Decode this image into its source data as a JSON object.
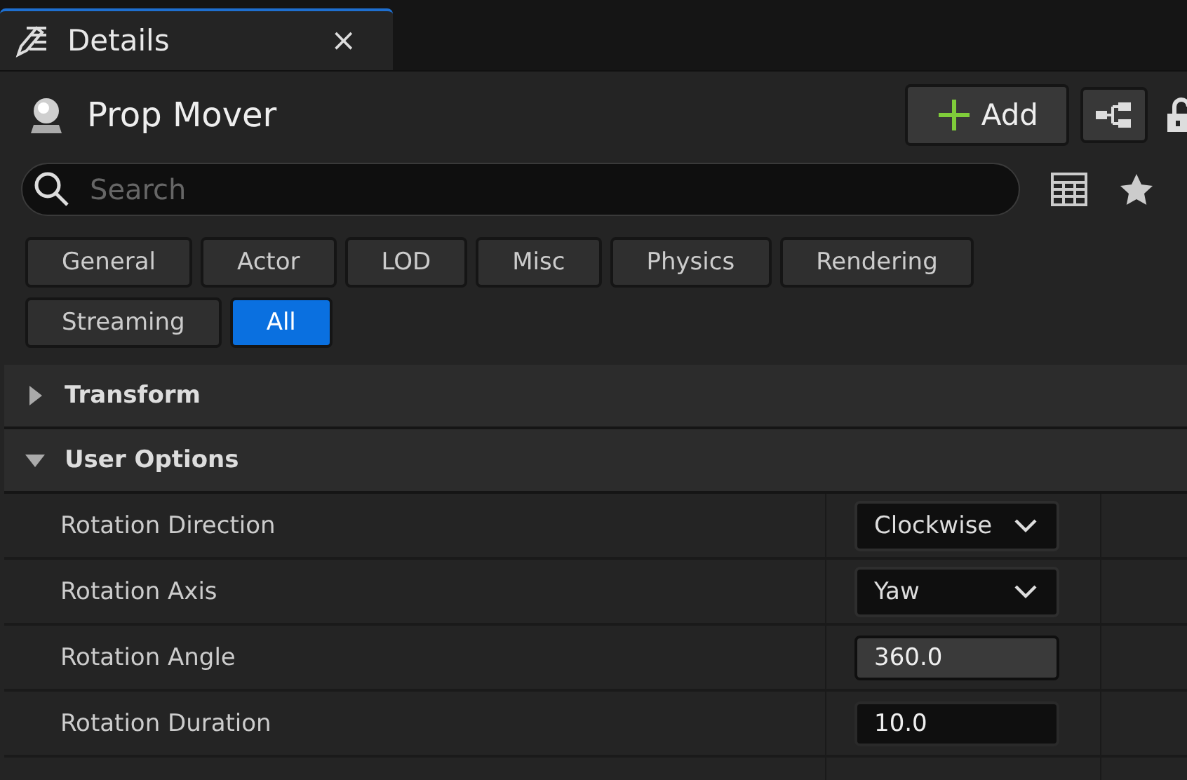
{
  "tab": {
    "title": "Details",
    "close": "×"
  },
  "header": {
    "title": "Prop Mover",
    "add_button": "Add"
  },
  "search": {
    "placeholder": "Search"
  },
  "filters": [
    {
      "label": "General",
      "selected": false
    },
    {
      "label": "Actor",
      "selected": false
    },
    {
      "label": "LOD",
      "selected": false
    },
    {
      "label": "Misc",
      "selected": false
    },
    {
      "label": "Physics",
      "selected": false
    },
    {
      "label": "Rendering",
      "selected": false
    },
    {
      "label": "Streaming",
      "selected": false
    },
    {
      "label": "All",
      "selected": true
    }
  ],
  "sections": [
    {
      "title": "Transform",
      "expanded": false
    },
    {
      "title": "User Options",
      "expanded": true,
      "properties": [
        {
          "label": "Rotation Direction",
          "kind": "dropdown",
          "value": "Clockwise"
        },
        {
          "label": "Rotation Axis",
          "kind": "dropdown",
          "value": "Yaw"
        },
        {
          "label": "Rotation Angle",
          "kind": "number",
          "value": "360.0",
          "focused": true
        },
        {
          "label": "Rotation Duration",
          "kind": "number",
          "value": "10.0",
          "focused": false
        }
      ]
    }
  ]
}
